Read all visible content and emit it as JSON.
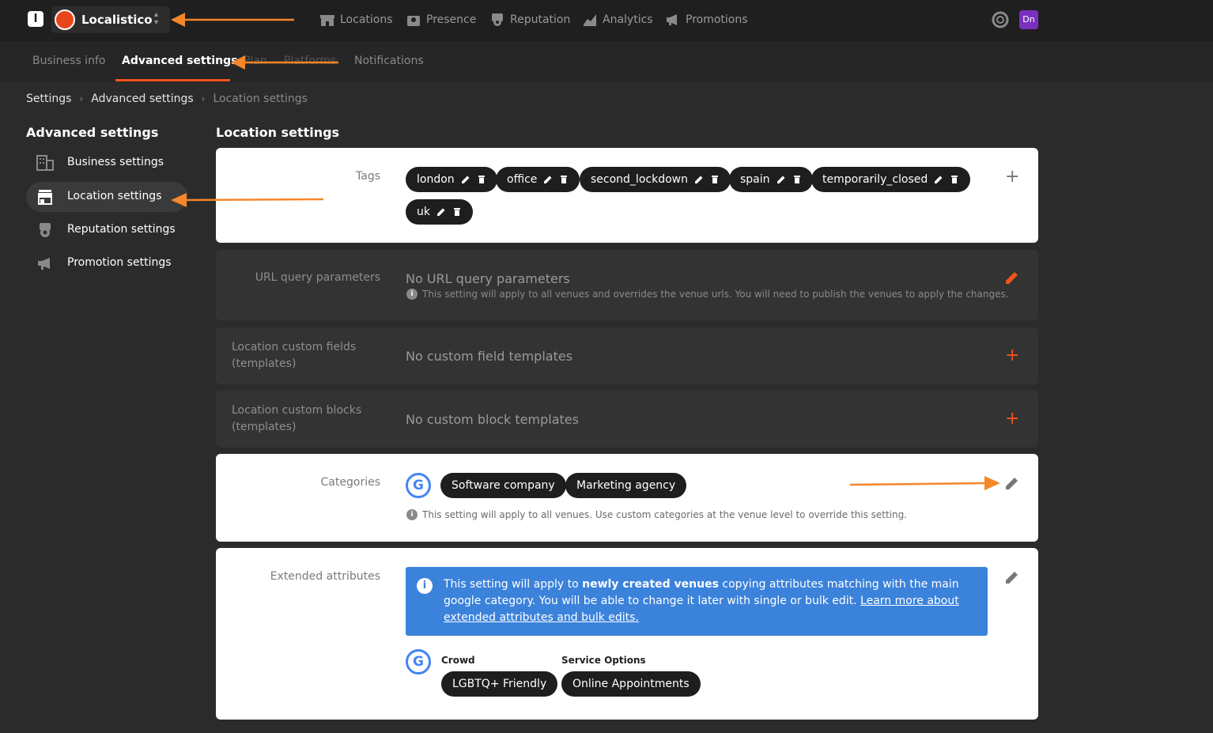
{
  "topbar": {
    "business_name": "Localistico",
    "nav": [
      {
        "label": "Locations",
        "icon": "building-icon"
      },
      {
        "label": "Presence",
        "icon": "location-pin-icon"
      },
      {
        "label": "Reputation",
        "icon": "reputation-icon"
      },
      {
        "label": "Analytics",
        "icon": "analytics-icon"
      },
      {
        "label": "Promotions",
        "icon": "megaphone-icon"
      }
    ],
    "user_initials": "Dn"
  },
  "subtabs": [
    "Business info",
    "Advanced settings",
    "Plan",
    "Platforms",
    "Notifications"
  ],
  "breadcrumb": [
    "Settings",
    "Advanced settings",
    "Location settings"
  ],
  "sidebar": {
    "title": "Advanced settings",
    "items": [
      {
        "label": "Business settings"
      },
      {
        "label": "Location settings"
      },
      {
        "label": "Reputation settings"
      },
      {
        "label": "Promotion settings"
      }
    ]
  },
  "main": {
    "title": "Location settings",
    "tags": {
      "label": "Tags",
      "items": [
        "london",
        "office",
        "second_lockdown",
        "spain",
        "temporarily_closed",
        "uk"
      ]
    },
    "url_params": {
      "label": "URL query parameters",
      "value": "No URL query parameters",
      "note": "This setting will apply to all venues and overrides the venue urls. You will need to publish the venues to apply the changes."
    },
    "custom_fields": {
      "label_line1": "Location custom fields",
      "label_line2": "(templates)",
      "value": "No custom field templates"
    },
    "custom_blocks": {
      "label_line1": "Location custom blocks",
      "label_line2": "(templates)",
      "value": "No custom block templates"
    },
    "categories": {
      "label": "Categories",
      "items": [
        "Software company",
        "Marketing agency"
      ],
      "note": "This setting will apply to all venues. Use custom categories at the venue level to override this setting."
    },
    "extended": {
      "label": "Extended attributes",
      "banner_pre": "This setting will apply to ",
      "banner_bold": "newly created venues",
      "banner_post": " copying attributes matching with the main google category. You will be able to change it later with single or bulk edit. ",
      "banner_link": "Learn more about extended attributes and bulk edits.",
      "groups": [
        {
          "title": "Crowd",
          "value": "LGBTQ+ Friendly"
        },
        {
          "title": "Service Options",
          "value": "Online Appointments"
        }
      ]
    }
  },
  "colors": {
    "accent": "#f2541b",
    "annotation_arrow": "#f5862a",
    "info_blue": "#3b82db"
  }
}
